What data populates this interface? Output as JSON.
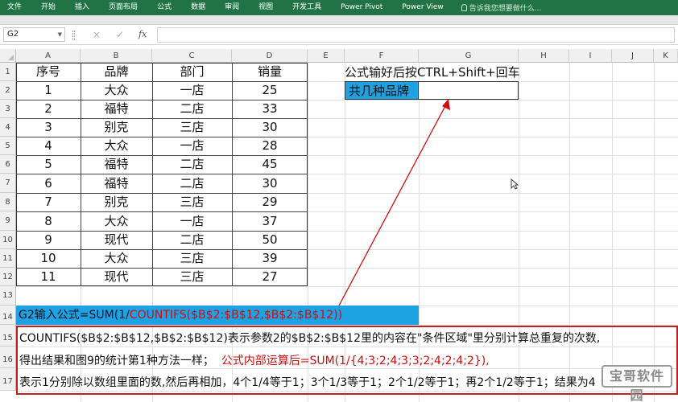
{
  "ribbon": {
    "tabs": [
      "文件",
      "开始",
      "插入",
      "页面布局",
      "公式",
      "数据",
      "审阅",
      "视图",
      "开发工具",
      "Power Pivot",
      "Power View"
    ],
    "tell_me": "告诉我您想要做什么..."
  },
  "formula_bar": {
    "name_box": "G2",
    "cancel_icon": "×",
    "enter_icon": "✓",
    "fx_label": "fx",
    "content": ""
  },
  "sheet": {
    "columns": [
      "A",
      "B",
      "C",
      "D",
      "E",
      "F",
      "G",
      "H",
      "I",
      "J",
      "K"
    ],
    "rows": [
      "1",
      "2",
      "3",
      "4",
      "5",
      "6",
      "7",
      "8",
      "9",
      "10",
      "11",
      "12",
      "13",
      "14",
      "15",
      "16",
      "17"
    ],
    "table_headers": [
      "序号",
      "品牌",
      "部门",
      "销量"
    ],
    "table_rows": [
      [
        "1",
        "大众",
        "一店",
        "25"
      ],
      [
        "2",
        "福特",
        "二店",
        "33"
      ],
      [
        "3",
        "别克",
        "三店",
        "30"
      ],
      [
        "4",
        "大众",
        "一店",
        "28"
      ],
      [
        "5",
        "福特",
        "二店",
        "45"
      ],
      [
        "6",
        "福特",
        "二店",
        "30"
      ],
      [
        "7",
        "别克",
        "三店",
        "29"
      ],
      [
        "8",
        "大众",
        "一店",
        "37"
      ],
      [
        "9",
        "现代",
        "二店",
        "50"
      ],
      [
        "10",
        "大众",
        "三店",
        "39"
      ],
      [
        "11",
        "现代",
        "三店",
        "27"
      ]
    ],
    "note_f1": "公式输好后按CTRL+Shift+回车",
    "label_f2": "共几种品牌",
    "value_g2": ""
  },
  "annotation": {
    "formula_prefix": "G2输入公式=SUM(1/",
    "formula_red": "COUNTIFS($B$2:$B$12,$B$2:$B$12))",
    "line1": "COUNTIFS($B$2:$B$12,$B$2:$B$12)表示参数2的$B$2:$B$12里的内容在\"条件区域\"里分别计算总重复的次数,",
    "line2_black": "得出结果和图9的统计第1种方法一样；",
    "line2_red": "公式内部运算后=SUM(1/{4;3;2;4;3;3;2;4;2;4;2}),",
    "line3": "表示1分别除以数组里面的数,然后再相加，4个1/4等于1；3个1/3等于1；2个1/2等于1；再2个1/2等于1；结果为4"
  },
  "watermark": "宝哥软件园",
  "colors": {
    "ribbon": "#217346",
    "highlight": "#1fa2e3",
    "red": "#d10b0b",
    "border_red": "#c02020"
  }
}
